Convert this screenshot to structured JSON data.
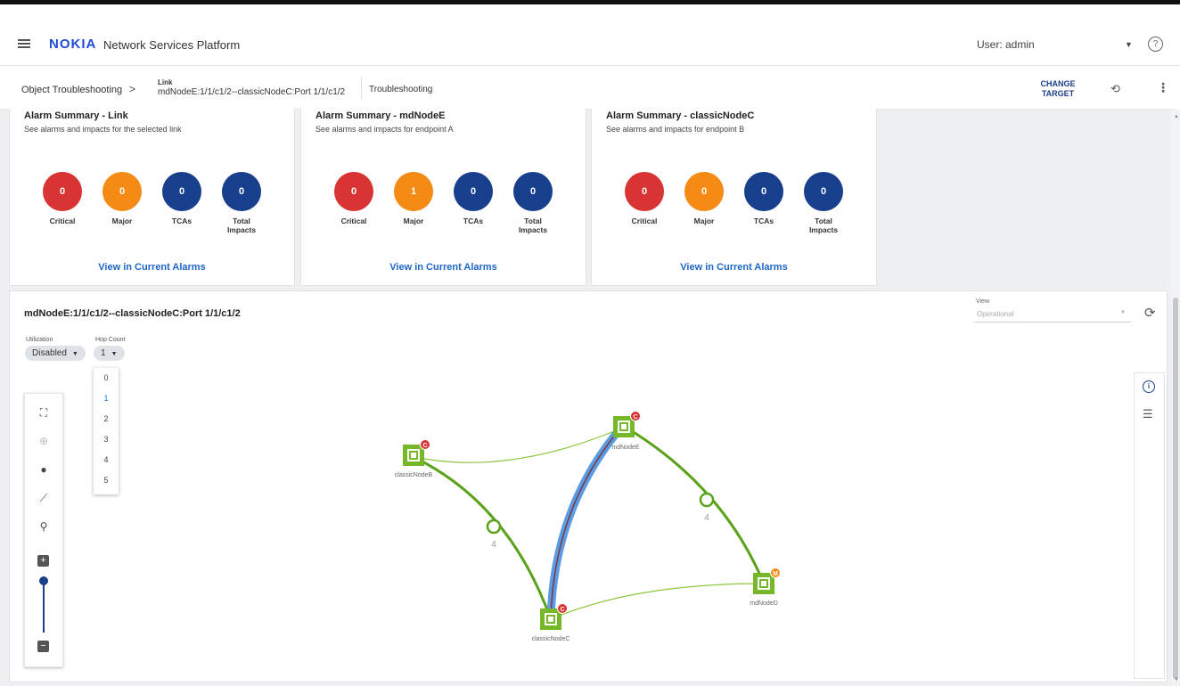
{
  "header": {
    "logo": "NOKIA",
    "app_title": "Network Services Platform",
    "user": "User: admin"
  },
  "breadcrumb": {
    "root": "Object Troubleshooting",
    "separator": ">",
    "object_type": "Link",
    "object_name": "mdNodeE:1/1/c1/2--classicNodeC:Port 1/1/c1/2",
    "tab": "Troubleshooting",
    "change_target": "CHANGE TARGET"
  },
  "alarm_cards": [
    {
      "title": "Alarm Summary - Link",
      "subtitle": "See alarms and impacts for the selected link",
      "counts": {
        "critical": "0",
        "major": "0",
        "tcas": "0",
        "total_impacts": "0"
      },
      "link": "View in Current Alarms"
    },
    {
      "title": "Alarm Summary - mdNodeE",
      "subtitle": "See alarms and impacts for endpoint A",
      "counts": {
        "critical": "0",
        "major": "1",
        "tcas": "0",
        "total_impacts": "0"
      },
      "link": "View in Current Alarms"
    },
    {
      "title": "Alarm Summary - classicNodeC",
      "subtitle": "See alarms and impacts for endpoint B",
      "counts": {
        "critical": "0",
        "major": "0",
        "tcas": "0",
        "total_impacts": "0"
      },
      "link": "View in Current Alarms"
    }
  ],
  "labels": {
    "critical": "Critical",
    "major": "Major",
    "tcas": "TCAs",
    "total_impacts_1": "Total",
    "total_impacts_2": "Impacts"
  },
  "colors": {
    "critical": "#d83434",
    "major": "#f58a14",
    "tcas": "#173f8e",
    "total_impacts": "#173f8e",
    "node": "#76b82a",
    "link_selected": "#5b9be6",
    "accent": "#1a3e8a"
  },
  "topology": {
    "title": "mdNodeE:1/1/c1/2--classicNodeC:Port 1/1/c1/2",
    "view_label": "View",
    "view_value": "Operational",
    "utilization_label": "Utilization",
    "utilization_value": "Disabled",
    "hop_count_label": "Hop Count",
    "hop_count_value": "1",
    "hop_options": [
      "0",
      "1",
      "2",
      "3",
      "4",
      "5"
    ],
    "hop_selected": "1",
    "nodes": [
      {
        "name": "classicNodeB",
        "badge": "C",
        "badge_color": "#d83434"
      },
      {
        "name": "mdNodeE",
        "badge": "C",
        "badge_color": "#d83434"
      },
      {
        "name": "classicNodeC",
        "badge": "C",
        "badge_color": "#d83434"
      },
      {
        "name": "mdNodeD",
        "badge": "M",
        "badge_color": "#f58a14"
      }
    ],
    "link_counts": [
      "4",
      "4"
    ]
  },
  "icons": {
    "toolbar": [
      "fit-screen-icon",
      "center-icon",
      "node-style-icon",
      "link-style-icon",
      "map-pin-icon",
      "zoom-in-icon",
      "zoom-out-icon"
    ],
    "side": [
      "info-icon",
      "list-icon"
    ]
  }
}
